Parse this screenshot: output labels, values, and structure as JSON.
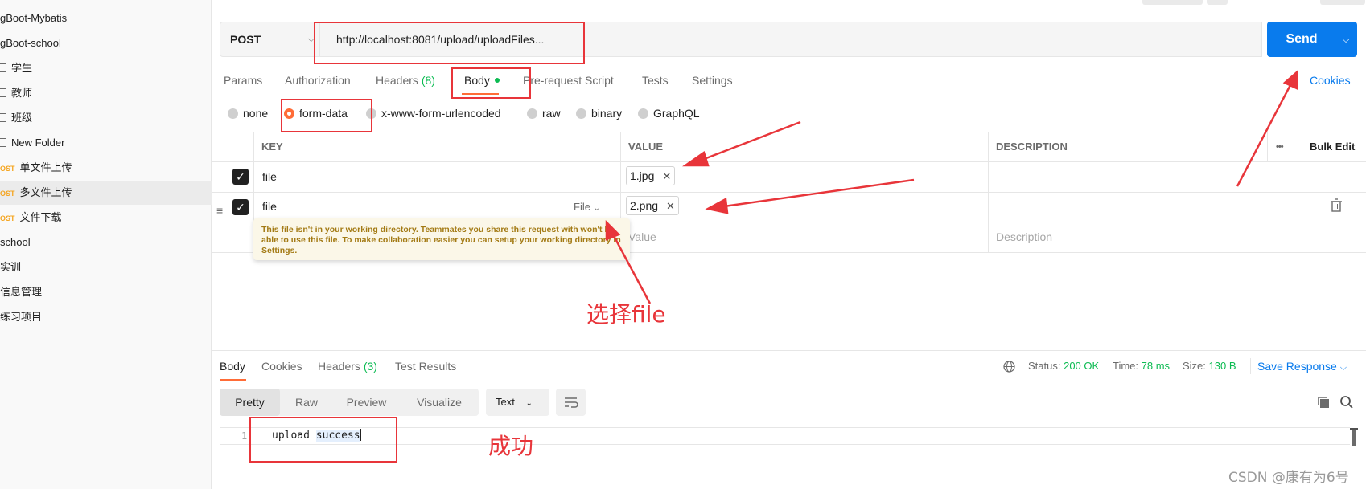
{
  "sidebar": {
    "items": [
      {
        "label": "gBoot-Mybatis",
        "kind": "collection"
      },
      {
        "label": "gBoot-school",
        "kind": "collection"
      },
      {
        "label": "学生",
        "kind": "folder"
      },
      {
        "label": "教师",
        "kind": "folder"
      },
      {
        "label": "班级",
        "kind": "folder"
      },
      {
        "label": "New Folder",
        "kind": "folder"
      },
      {
        "label": "单文件上传",
        "kind": "request",
        "method": "OST"
      },
      {
        "label": "多文件上传",
        "kind": "request",
        "method": "OST",
        "active": true
      },
      {
        "label": "文件下载",
        "kind": "request",
        "method": "OST"
      },
      {
        "label": "school",
        "kind": "collection"
      },
      {
        "label": "实训",
        "kind": "collection"
      },
      {
        "label": "信息管理",
        "kind": "collection"
      },
      {
        "label": "练习项目",
        "kind": "collection"
      }
    ]
  },
  "request": {
    "method": "POST",
    "url": "http://localhost:8081/upload/uploadFiles",
    "url_ellipsis": "...",
    "send_label": "Send",
    "tabs": [
      {
        "label": "Params"
      },
      {
        "label": "Authorization"
      },
      {
        "label": "Headers",
        "count": "(8)"
      },
      {
        "label": "Body",
        "active": true
      },
      {
        "label": "Pre-request Script"
      },
      {
        "label": "Tests"
      },
      {
        "label": "Settings"
      }
    ],
    "cookies_label": "Cookies",
    "body_types": [
      {
        "label": "none"
      },
      {
        "label": "form-data",
        "selected": true
      },
      {
        "label": "x-www-form-urlencoded"
      },
      {
        "label": "raw"
      },
      {
        "label": "binary"
      },
      {
        "label": "GraphQL"
      }
    ]
  },
  "params_table": {
    "headers": {
      "key": "KEY",
      "value": "VALUE",
      "description": "DESCRIPTION",
      "more": "•••",
      "bulk_edit": "Bulk Edit"
    },
    "rows": [
      {
        "key": "file",
        "value": "1.jpg",
        "checked": true
      },
      {
        "key": "file",
        "value": "2.png",
        "checked": true,
        "type_select": "File"
      }
    ],
    "placeholder_value": "Value",
    "placeholder_description": "Description",
    "tooltip": "This file isn't in your working directory. Teammates you share this request with won't be able to use this file. To make collaboration easier you can setup your working directory in Settings."
  },
  "annotations": {
    "select_file": "选择file",
    "success": "成功"
  },
  "response": {
    "tabs": [
      {
        "label": "Body",
        "active": true
      },
      {
        "label": "Cookies"
      },
      {
        "label": "Headers",
        "count": "(3)"
      },
      {
        "label": "Test Results"
      }
    ],
    "status_label": "Status:",
    "status_value": "200 OK",
    "time_label": "Time:",
    "time_value": "78 ms",
    "size_label": "Size:",
    "size_value": "130 B",
    "save_label": "Save Response",
    "formats": [
      "Pretty",
      "Raw",
      "Preview",
      "Visualize"
    ],
    "active_format": "Pretty",
    "language": "Text",
    "line_number": "1",
    "code_word1": "upload",
    "code_word2": "success"
  },
  "watermark": "CSDN @康有为6号",
  "colors": {
    "accent": "#ff6c37",
    "send_blue": "#097bed",
    "status_green": "#0cbb52",
    "annotation_red": "#e8353a"
  }
}
